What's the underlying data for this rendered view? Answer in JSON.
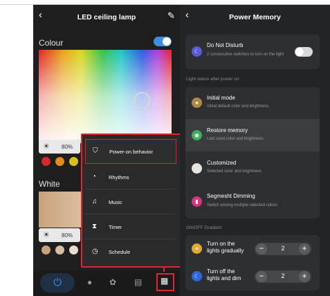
{
  "left": {
    "title": "LED ceiling lamp",
    "colour_label": "Colour",
    "white_label": "White",
    "colour_brightness": "80%",
    "white_brightness": "80%",
    "colour_swatches": [
      "#d9262b",
      "#e08b1c",
      "#d6c21b",
      "#2a7f2a"
    ],
    "white_swatches": [
      "#c9a27c",
      "#d9bda0",
      "#e9dccb"
    ],
    "accent": "#3a8ee6",
    "menu": [
      {
        "label": "Power-on behavior",
        "icon": "power-behavior-icon"
      },
      {
        "label": "Rhythms",
        "icon": "rhythms-icon"
      },
      {
        "label": "Music",
        "icon": "music-icon"
      },
      {
        "label": "Timer",
        "icon": "timer-icon"
      },
      {
        "label": "Schedule",
        "icon": "schedule-icon"
      }
    ],
    "highlight_color": "#e1262f"
  },
  "right": {
    "title": "Power Memory",
    "dnd": {
      "title": "Do Not Disturb",
      "desc": "2 consecutive switches to turn on the light"
    },
    "light_status_header": "Light status after power on",
    "modes": [
      {
        "title": "Initial mode",
        "desc": "Initial default color and brightness",
        "color": "#b08a45"
      },
      {
        "title": "Restore memory",
        "desc": "Last used color and brightness",
        "color": "#3fae5a"
      },
      {
        "title": "Customized",
        "desc": "Selected color and brightness",
        "color": "#e8e3df"
      },
      {
        "title": "Segmesht Dimming",
        "desc": "Switch among multiple selected colors",
        "color": "#d8357d"
      }
    ],
    "gradient_header": "ON/OFF Gradient",
    "gradients": [
      {
        "label": "Turn on the lights gradually",
        "label_l1": "Turn on the",
        "label_l2": "lights gradually",
        "value": "2",
        "color": "#e2a92e"
      },
      {
        "label": "Turn off the lights and dim",
        "label_l1": "Turn off the",
        "label_l2": "lights and dim",
        "value": "2",
        "color": "#2f68d8"
      }
    ],
    "minus": "−",
    "plus": "+"
  }
}
